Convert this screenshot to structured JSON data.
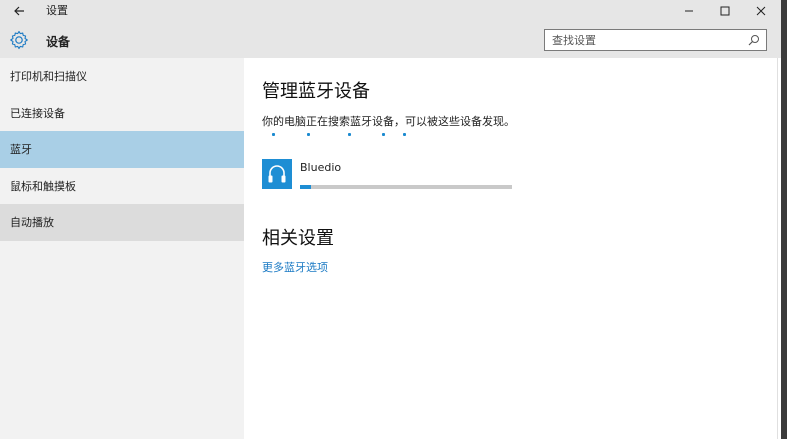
{
  "titlebar": {
    "back_icon": "arrow-left-icon",
    "title": "设置",
    "min_label": "–",
    "close_label": "✕"
  },
  "header": {
    "icon": "gear-icon",
    "title": "设备",
    "search_placeholder": "查找设置"
  },
  "sidebar": {
    "items": [
      {
        "label": "打印机和扫描仪",
        "state": "normal"
      },
      {
        "label": "已连接设备",
        "state": "normal"
      },
      {
        "label": "蓝牙",
        "state": "selected"
      },
      {
        "label": "鼠标和触摸板",
        "state": "normal"
      },
      {
        "label": "自动播放",
        "state": "hover"
      }
    ]
  },
  "main": {
    "title": "管理蓝牙设备",
    "status": "你的电脑正在搜索蓝牙设备，可以被这些设备发现。",
    "device": {
      "name": "Bluedio",
      "icon": "headphones-icon",
      "progress": 0.05
    },
    "related_title": "相关设置",
    "related_link": "更多蓝牙选项"
  },
  "colors": {
    "accent": "#1e8ed4",
    "selected_bg": "#a9cfe6",
    "chrome_bg": "#e6e6e6",
    "sidebar_bg": "#f2f2f2"
  }
}
